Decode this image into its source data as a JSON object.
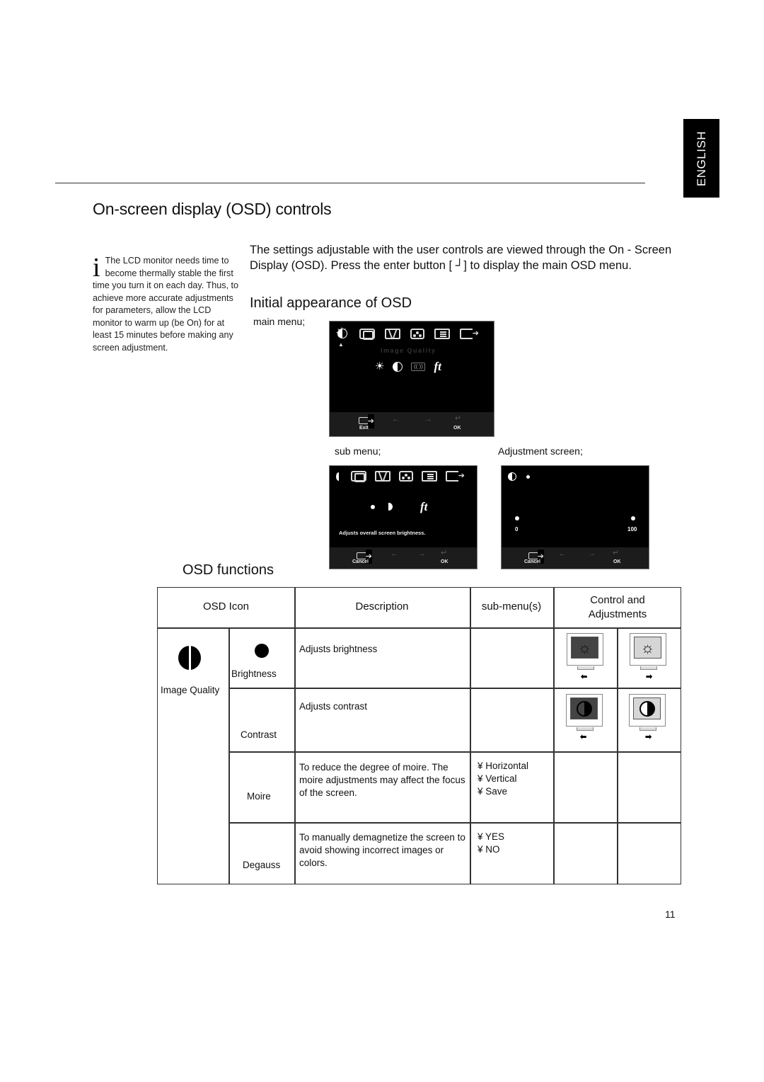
{
  "language_tab": "ENGLISH",
  "page_title": "On-screen display (OSD) controls",
  "note": {
    "icon": "info-icon",
    "icon_glyph": "i",
    "text": "The LCD monitor needs time to become thermally stable the first time you turn it on each day. Thus, to achieve more accurate adjustments for parameters, allow the LCD monitor to warm up (be On) for at least 15 minutes before making any screen adjustment."
  },
  "intro": "The settings adjustable with the user controls are viewed through the On - Screen Display (OSD). Press the enter button [  ┘] to display the main OSD menu.",
  "initial_appearance_title": "Initial appearance of OSD",
  "labels": {
    "main_menu": "main menu;",
    "sub_menu": "sub menu;",
    "adjustment_screen": "Adjustment screen;"
  },
  "osd_main": {
    "category_label": "Image Quality",
    "top_icons": [
      "image-quality-icon",
      "image-position-icon",
      "image-setup-icon",
      "color-icon",
      "options-icon",
      "exit-icon"
    ],
    "sub_icons": [
      "brightness-icon",
      "contrast-icon",
      "moire-icon",
      "degauss-icon"
    ],
    "bar": {
      "left": "Exit",
      "right": "OK"
    }
  },
  "osd_sub": {
    "help_text": "Adjusts overall screen brightness.",
    "bar": {
      "left": "Cancel",
      "right": "OK"
    }
  },
  "osd_adjust": {
    "min_label": "0",
    "max_label": "100",
    "bar": {
      "left": "Cancel",
      "right": "OK"
    }
  },
  "osd_functions_title": "OSD functions",
  "table": {
    "headers": {
      "osd_icon": "OSD Icon",
      "description": "Description",
      "sub_menus": "sub-menu(s)",
      "control": "Control and Adjustments"
    },
    "group": {
      "label": "Image Quality",
      "icon": "image-quality-icon"
    },
    "rows": [
      {
        "name": "Brightness",
        "icon": "brightness-icon",
        "description": "Adjusts brightness",
        "submenus": [],
        "controls": [
          "darker-screen-left",
          "brighter-screen-right"
        ]
      },
      {
        "name": "Contrast",
        "icon": "contrast-icon",
        "description": "Adjusts contrast",
        "submenus": [],
        "controls": [
          "lower-contrast-left",
          "higher-contrast-right"
        ]
      },
      {
        "name": "Moire",
        "description": "To reduce the degree of moire. The moire adjustments may affect the focus of the screen.",
        "submenus": [
          "¥ Horizontal",
          "¥ Vertical",
          "¥ Save"
        ]
      },
      {
        "name": "Degauss",
        "description": "To manually demagnetize the screen to avoid showing incorrect images or colors.",
        "submenus": [
          "¥ YES",
          "¥ NO"
        ]
      }
    ]
  },
  "page_number": "11",
  "colors": {
    "osd_bg": "#000000",
    "osd_bar": "#1c1c1c",
    "dark_screen": "#444444",
    "light_screen": "#d6d6d6"
  }
}
